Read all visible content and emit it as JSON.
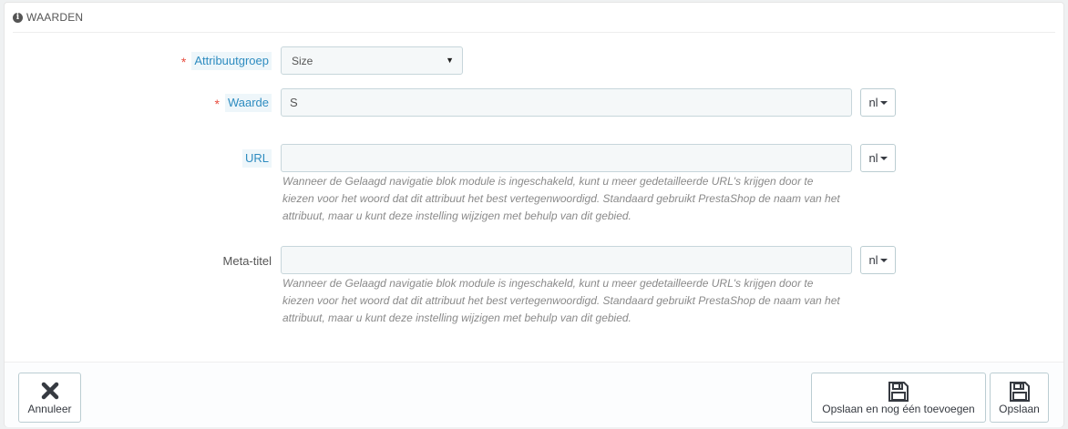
{
  "panel": {
    "heading_icon": "info-icon",
    "heading": "WAARDEN"
  },
  "form": {
    "group": {
      "label": "Attribuutgroep",
      "required": true,
      "selected": "Size"
    },
    "value": {
      "label": "Waarde",
      "required": true,
      "input": "S",
      "lang": "nl"
    },
    "url": {
      "label": "URL",
      "input": "",
      "lang": "nl",
      "help": "Wanneer de Gelaagd navigatie blok module is ingeschakeld, kunt u meer gedetailleerde URL's krijgen door te kiezen voor het woord dat dit attribuut het best vertegenwoordigd. Standaard gebruikt PrestaShop de naam van het attribuut, maar u kunt deze instelling wijzigen met behulp van dit gebied."
    },
    "meta": {
      "label": "Meta-titel",
      "input": "",
      "lang": "nl",
      "help": "Wanneer de Gelaagd navigatie blok module is ingeschakeld, kunt u meer gedetailleerde URL's krijgen door te kiezen voor het woord dat dit attribuut het best vertegenwoordigd. Standaard gebruikt PrestaShop de naam van het attribuut, maar u kunt deze instelling wijzigen met behulp van dit gebied."
    }
  },
  "footer": {
    "cancel_label": "Annuleer",
    "cancel_icon": "close-icon",
    "save_add_label": "Opslaan en nog één toevoegen",
    "save_add_icon": "save-icon",
    "save_label": "Opslaan",
    "save_icon": "save-icon"
  },
  "colors": {
    "required": "#e84e40",
    "hint_label": "#2e8cc0",
    "input_bg": "#f5f8f9"
  }
}
